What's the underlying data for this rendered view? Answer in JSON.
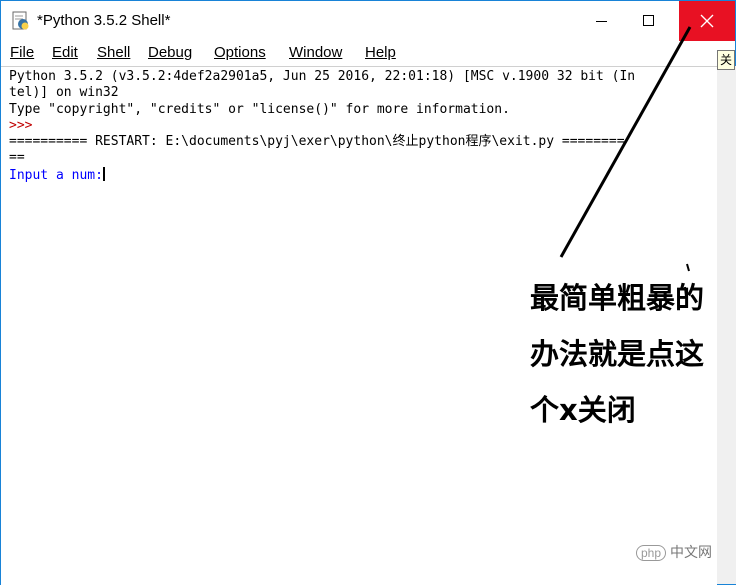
{
  "window": {
    "title": "*Python 3.5.2 Shell*",
    "close_color": "#e81123"
  },
  "menu": [
    {
      "label": "File"
    },
    {
      "label": "Edit"
    },
    {
      "label": "Shell"
    },
    {
      "label": "Debug"
    },
    {
      "label": "Options"
    },
    {
      "label": "Window"
    },
    {
      "label": "Help"
    }
  ],
  "shell": {
    "line1": "Python 3.5.2 (v3.5.2:4def2a2901a5, Jun 25 2016, 22:01:18) [MSC v.1900 32 bit (In",
    "line2": "tel)] on win32",
    "line3": "Type \"copyright\", \"credits\" or \"license()\" for more information.",
    "prompt": ">>>",
    "restart_line": "========== RESTART: E:\\documents\\pyj\\exer\\python\\终止python程序\\exit.py ========",
    "restart_wrap": "==",
    "input_prompt": "Input a num:"
  },
  "tooltip_peek": "关",
  "annotation": {
    "line1": "最简单粗暴的",
    "line2": "办法就是点这",
    "line3": "个x关闭"
  },
  "watermark": {
    "logo": "php",
    "text": "中文网"
  }
}
